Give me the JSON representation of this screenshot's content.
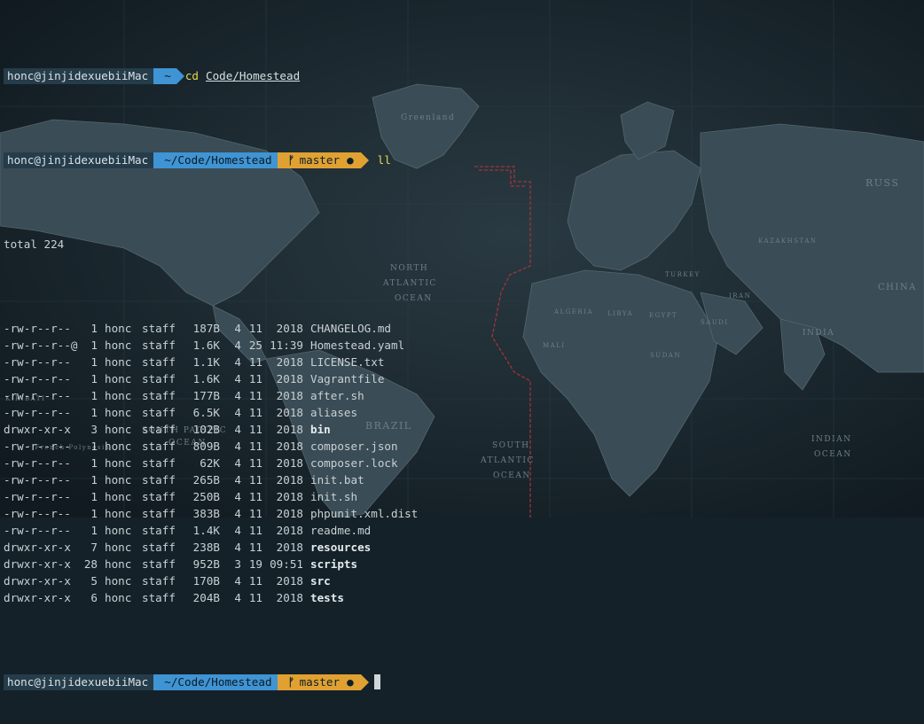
{
  "prompt": {
    "user": "honc@jinjidexuebiiMac",
    "home_path": "~",
    "path": "~/Code/Homestead",
    "branch": "master",
    "dirty_indicator": "●"
  },
  "command1": {
    "name": "cd",
    "arg": "Code/Homestead"
  },
  "command2": {
    "name": "ll"
  },
  "listing_total": "total 224",
  "files": [
    {
      "perm": "-rw-r--r--",
      "links": "1",
      "user": "honc",
      "group": "staff",
      "size": "187B",
      "month": "4",
      "day": "11",
      "time": "2018",
      "name": "CHANGELOG.md",
      "dir": false
    },
    {
      "perm": "-rw-r--r--@",
      "links": "1",
      "user": "honc",
      "group": "staff",
      "size": "1.6K",
      "month": "4",
      "day": "25",
      "time": "11:39",
      "name": "Homestead.yaml",
      "dir": false
    },
    {
      "perm": "-rw-r--r--",
      "links": "1",
      "user": "honc",
      "group": "staff",
      "size": "1.1K",
      "month": "4",
      "day": "11",
      "time": "2018",
      "name": "LICENSE.txt",
      "dir": false
    },
    {
      "perm": "-rw-r--r--",
      "links": "1",
      "user": "honc",
      "group": "staff",
      "size": "1.6K",
      "month": "4",
      "day": "11",
      "time": "2018",
      "name": "Vagrantfile",
      "dir": false
    },
    {
      "perm": "-rw-r--r--",
      "links": "1",
      "user": "honc",
      "group": "staff",
      "size": "177B",
      "month": "4",
      "day": "11",
      "time": "2018",
      "name": "after.sh",
      "dir": false
    },
    {
      "perm": "-rw-r--r--",
      "links": "1",
      "user": "honc",
      "group": "staff",
      "size": "6.5K",
      "month": "4",
      "day": "11",
      "time": "2018",
      "name": "aliases",
      "dir": false
    },
    {
      "perm": "drwxr-xr-x",
      "links": "3",
      "user": "honc",
      "group": "staff",
      "size": "102B",
      "month": "4",
      "day": "11",
      "time": "2018",
      "name": "bin",
      "dir": true
    },
    {
      "perm": "-rw-r--r--",
      "links": "1",
      "user": "honc",
      "group": "staff",
      "size": "809B",
      "month": "4",
      "day": "11",
      "time": "2018",
      "name": "composer.json",
      "dir": false
    },
    {
      "perm": "-rw-r--r--",
      "links": "1",
      "user": "honc",
      "group": "staff",
      "size": "62K",
      "month": "4",
      "day": "11",
      "time": "2018",
      "name": "composer.lock",
      "dir": false
    },
    {
      "perm": "-rw-r--r--",
      "links": "1",
      "user": "honc",
      "group": "staff",
      "size": "265B",
      "month": "4",
      "day": "11",
      "time": "2018",
      "name": "init.bat",
      "dir": false
    },
    {
      "perm": "-rw-r--r--",
      "links": "1",
      "user": "honc",
      "group": "staff",
      "size": "250B",
      "month": "4",
      "day": "11",
      "time": "2018",
      "name": "init.sh",
      "dir": false
    },
    {
      "perm": "-rw-r--r--",
      "links": "1",
      "user": "honc",
      "group": "staff",
      "size": "383B",
      "month": "4",
      "day": "11",
      "time": "2018",
      "name": "phpunit.xml.dist",
      "dir": false
    },
    {
      "perm": "-rw-r--r--",
      "links": "1",
      "user": "honc",
      "group": "staff",
      "size": "1.4K",
      "month": "4",
      "day": "11",
      "time": "2018",
      "name": "readme.md",
      "dir": false
    },
    {
      "perm": "drwxr-xr-x",
      "links": "7",
      "user": "honc",
      "group": "staff",
      "size": "238B",
      "month": "4",
      "day": "11",
      "time": "2018",
      "name": "resources",
      "dir": true
    },
    {
      "perm": "drwxr-xr-x",
      "links": "28",
      "user": "honc",
      "group": "staff",
      "size": "952B",
      "month": "3",
      "day": "19",
      "time": "09:51",
      "name": "scripts",
      "dir": true
    },
    {
      "perm": "drwxr-xr-x",
      "links": "5",
      "user": "honc",
      "group": "staff",
      "size": "170B",
      "month": "4",
      "day": "11",
      "time": "2018",
      "name": "src",
      "dir": true
    },
    {
      "perm": "drwxr-xr-x",
      "links": "6",
      "user": "honc",
      "group": "staff",
      "size": "204B",
      "month": "4",
      "day": "11",
      "time": "2018",
      "name": "tests",
      "dir": true
    }
  ],
  "map_labels": {
    "greenland": "Greenland",
    "north_atlantic_1": "NORTH",
    "north_atlantic_2": "ATLANTIC",
    "north_atlantic_3": "OCEAN",
    "south_pacific_1": "SOUTH PACIFIC",
    "south_pacific_2": "OCEAN",
    "south_atlantic_1": "SOUTH",
    "south_atlantic_2": "ATLANTIC",
    "south_atlantic_3": "OCEAN",
    "indian_ocean_1": "INDIAN",
    "indian_ocean_2": "OCEAN",
    "brazil": "BRAZIL",
    "russia": "RUSS",
    "china": "CHINA",
    "india": "INDIA",
    "iran": "IRAN",
    "kazakhstan": "KAZAKHSTAN",
    "turkey": "TURKEY",
    "algeria": "ALGERIA",
    "libya": "LIBYA",
    "egypt": "EGYPT",
    "saudi": "SAUDI",
    "sudan": "SUDAN",
    "mali": "MALI",
    "kiribati": "KIRIBATI",
    "french_polynesia": "• French Polynesia"
  }
}
